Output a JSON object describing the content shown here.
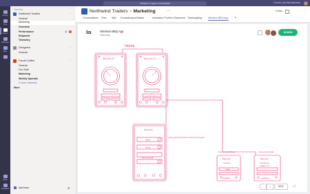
{
  "titlebar": {
    "search_placeholder": "Search or type a command",
    "org": "Fourth | ad interactivetm"
  },
  "rail": [
    {
      "label": "Activity",
      "icon": "bell-icon"
    },
    {
      "label": "Chat",
      "icon": "chat-icon"
    },
    {
      "label": "Teams",
      "icon": "teams-icon",
      "active": true
    },
    {
      "label": "Meetings",
      "icon": "calendar-icon"
    },
    {
      "label": "Files",
      "icon": "file-icon"
    },
    {
      "label": "...",
      "icon": "more-icon"
    }
  ],
  "rail_bottom": [
    {
      "label": "Store",
      "icon": "store-icon"
    },
    {
      "label": "Feedback",
      "icon": "feedback-icon"
    }
  ],
  "sidebar": {
    "favorites_label": "Favorites",
    "teams": [
      {
        "name": "Northwind Traders",
        "color": "#2b5eb5"
      },
      {
        "name": "Designers",
        "color": "#8c8c8c"
      },
      {
        "name": "Fourth Coffee",
        "color": "#d83b01"
      }
    ],
    "channels_team1": [
      {
        "name": "General"
      },
      {
        "name": "Marketing",
        "selected": true
      },
      {
        "name": "Overview",
        "bold": true
      },
      {
        "name": "Performance",
        "bold": true
      },
      {
        "name": "Shipment",
        "bold": true
      },
      {
        "name": "Telemetry",
        "bold": true
      }
    ],
    "channels_team2": [
      {
        "name": "General"
      }
    ],
    "channels_team3": [
      {
        "name": "General"
      },
      {
        "name": "Fun Stuff"
      },
      {
        "name": "Marketing",
        "bold": true
      },
      {
        "name": "Weekly Specials",
        "bold": true
      },
      {
        "name": "3 more channels",
        "more": true
      }
    ],
    "mention_marker": "@",
    "badge": "1",
    "more_label": "More",
    "add_team": "Add team"
  },
  "header": {
    "team": "Northwind Traders",
    "separator": ">",
    "channel": "Marketing",
    "dots": "...",
    "tabs": [
      "Conversations",
      "Files",
      "Wiki",
      "Fundraising w/Alistair",
      "Instinction Problem Statement",
      "Thanksgiving",
      "Wireless BBQ App"
    ],
    "active_tab": 6,
    "add_tab": "+",
    "follow": "Follow",
    "more_in_header": "..."
  },
  "content": {
    "logo": "in",
    "project_name": "Wireless BBQ App",
    "view_only": "View only",
    "share": "SHARE",
    "zoom": "50%",
    "zoom_minus": "-",
    "zoom_plus": "+",
    "zoom_fit": "⤢"
  },
  "wireframe": {
    "home_label": "Home",
    "unconnected_label": "Unconnected State",
    "connected_label": "Connected State",
    "phone1_title": "Bluetooth Off",
    "phone2_title": "Bluetooth On",
    "detail_title": "Bluetooth",
    "detail_rows": [
      "Meat",
      "Temp",
      "Time Interval"
    ],
    "detail_note": "Toggle notify on/off and time interval for temp alert",
    "unc_lines": [
      "Bluetooth",
      "Connect",
      "Login",
      "Feedback",
      "Help"
    ],
    "con_lines": [
      "Bluetooth",
      "Connected",
      "Logged In as",
      "Feedback",
      "Help"
    ]
  },
  "accent_color": "#6264a7",
  "wire_color": "#e8356a"
}
